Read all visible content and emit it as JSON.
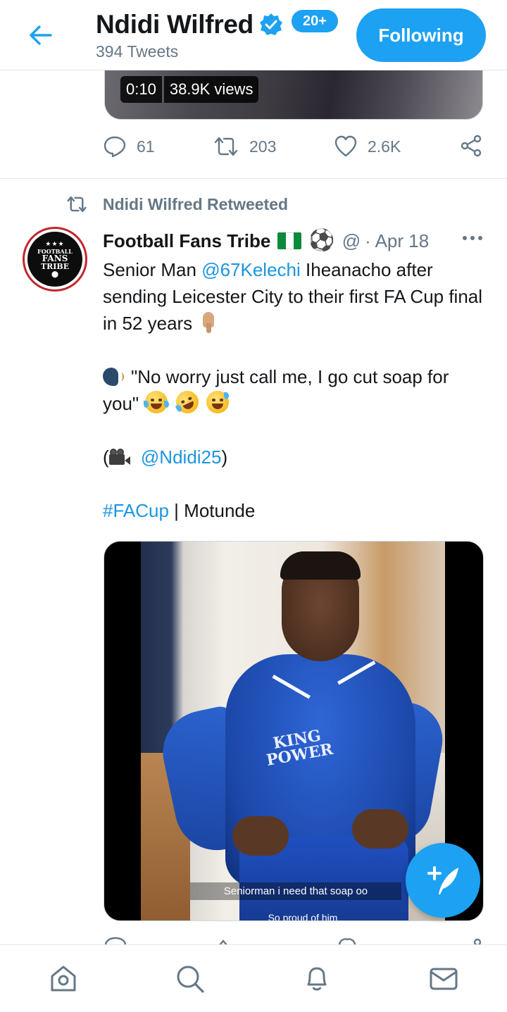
{
  "header": {
    "name": "Ndidi Wilfred",
    "tweet_count": "394 Tweets",
    "follow_button": "Following"
  },
  "prev_tweet": {
    "video_duration": "0:10",
    "video_views": "38.9K views",
    "replies": "61",
    "retweets": "203",
    "likes": "2.6K"
  },
  "tweet": {
    "retweeted_by": "Ndidi Wilfred Retweeted",
    "author": "Football Fans Tribe",
    "handle": "@",
    "date": "· Apr 18",
    "avatar_text": [
      "FOOTBALL",
      "FANS",
      "TRIBE"
    ],
    "text_line1_pre": "Senior Man ",
    "mention1": "@67Kelechi",
    "text_line1_post": " Iheanacho after sending Leicester City to their first FA Cup final in 52 years",
    "quote": "\"No worry just call me, I go cut soap for you\"",
    "credit_open": "(",
    "mention2": "@Ndidi25",
    "credit_close": ")",
    "hashtag": "#FACup",
    "hashtag_suffix": " | Motunde",
    "video_caption": "Seniorman i need that soap oo",
    "video_caption2": "So proud of him",
    "video_sponsor_1": "KING",
    "video_sponsor_2": "POWER"
  },
  "bottom_nav": {
    "items": [
      "home-icon",
      "search-icon",
      "notifications-icon",
      "messages-icon"
    ],
    "notifications_badge": "20+"
  },
  "colors": {
    "accent": "#1da1f2",
    "link": "#1b95e0",
    "muted": "#657786"
  }
}
